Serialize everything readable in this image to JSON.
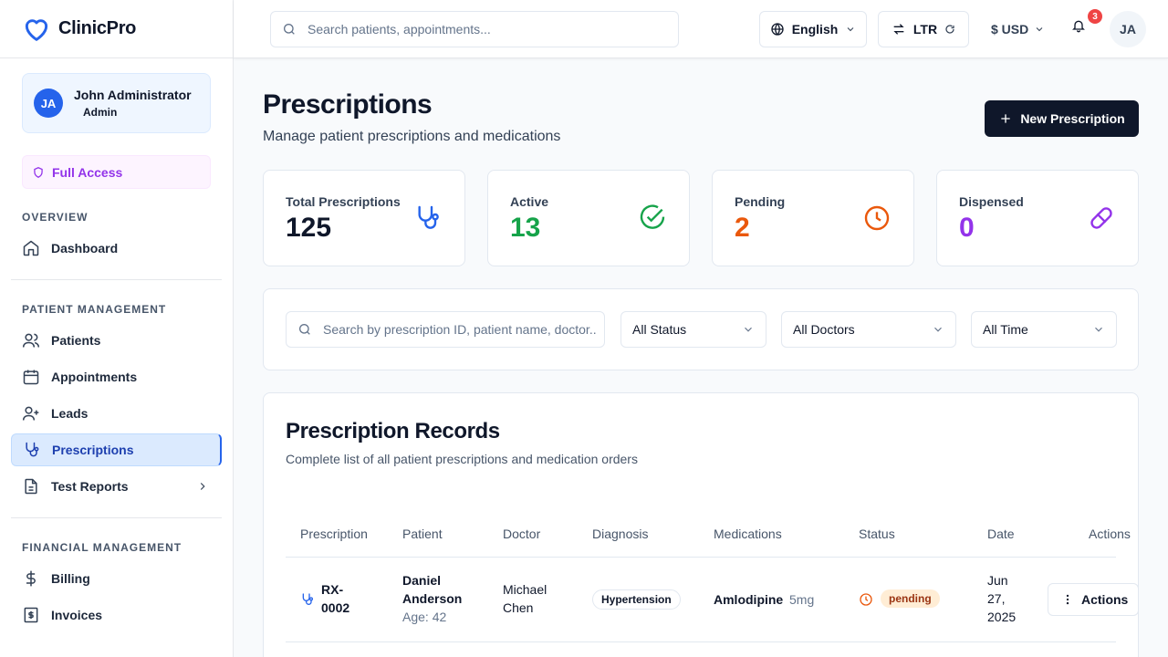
{
  "brand": {
    "name": "ClinicPro"
  },
  "user": {
    "initials": "JA",
    "name": "John Administrator",
    "role": "Admin"
  },
  "access": {
    "label": "Full Access"
  },
  "sidebar": {
    "sections": [
      {
        "label": "OVERVIEW"
      },
      {
        "label": "PATIENT MANAGEMENT"
      },
      {
        "label": "FINANCIAL MANAGEMENT"
      }
    ],
    "items": [
      {
        "label": "Dashboard",
        "icon": "home-icon"
      },
      {
        "label": "Patients",
        "icon": "users-icon"
      },
      {
        "label": "Appointments",
        "icon": "calendar-icon"
      },
      {
        "label": "Leads",
        "icon": "user-plus-icon"
      },
      {
        "label": "Prescriptions",
        "icon": "stethoscope-icon",
        "active": true
      },
      {
        "label": "Test Reports",
        "icon": "file-text-icon"
      },
      {
        "label": "Billing",
        "icon": "dollar-icon"
      },
      {
        "label": "Invoices",
        "icon": "receipt-icon"
      }
    ]
  },
  "header": {
    "search_placeholder": "Search patients, appointments...",
    "language": "English",
    "direction": "LTR",
    "currency": "$ USD",
    "notifications": "3",
    "avatar": "JA"
  },
  "page": {
    "title": "Prescriptions",
    "subtitle": "Manage patient prescriptions and medications",
    "new_button": "New Prescription"
  },
  "stats": [
    {
      "label": "Total Prescriptions",
      "value": "125",
      "color": "#0f172a",
      "icon": "stethoscope-icon"
    },
    {
      "label": "Active",
      "value": "13",
      "color": "#16a34a",
      "icon": "check-circle-icon"
    },
    {
      "label": "Pending",
      "value": "2",
      "color": "#ea580c",
      "icon": "clock-icon"
    },
    {
      "label": "Dispensed",
      "value": "0",
      "color": "#9333ea",
      "icon": "pill-icon"
    }
  ],
  "filters": {
    "search_placeholder": "Search by prescription ID, patient name, doctor...",
    "status": "All Status",
    "doctor": "All Doctors",
    "time": "All Time"
  },
  "records": {
    "title": "Prescription Records",
    "subtitle": "Complete list of all patient prescriptions and medication orders",
    "columns": [
      "Prescription",
      "Patient",
      "Doctor",
      "Diagnosis",
      "Medications",
      "Status",
      "Date",
      "Actions"
    ],
    "rows": [
      {
        "id_line1": "RX-",
        "id_line2": "0002",
        "patient_line1": "Daniel",
        "patient_line2": "Anderson",
        "age": "Age: 42",
        "doctor_line1": "Michael",
        "doctor_line2": "Chen",
        "diagnosis": "Hypertension",
        "medication": "Amlodipine",
        "dose": "5mg",
        "status": "pending",
        "date_line1": "Jun",
        "date_line2": "27,",
        "date_line3": "2025",
        "action": "Actions"
      }
    ]
  }
}
